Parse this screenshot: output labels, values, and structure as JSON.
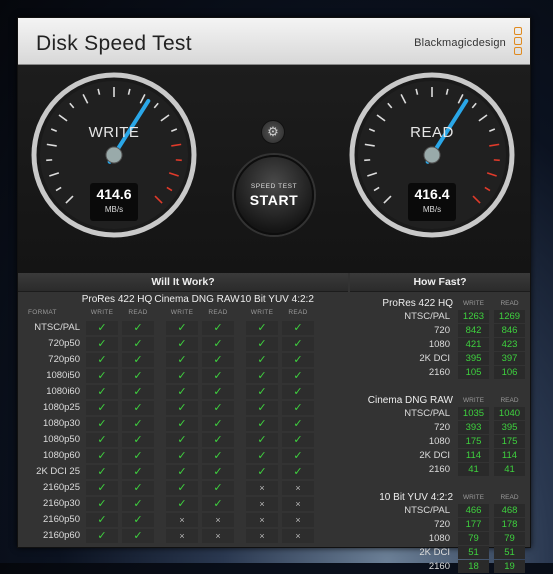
{
  "window": {
    "title": "Disk Speed Test",
    "brand": "Blackmagicdesign",
    "close_icon": "×"
  },
  "gauges": {
    "write": {
      "label": "WRITE",
      "value": "414.6",
      "unit": "MB/s",
      "fraction": 0.62
    },
    "read": {
      "label": "READ",
      "value": "416.4",
      "unit": "MB/s",
      "fraction": 0.62
    }
  },
  "start_button": {
    "small": "SPEED TEST",
    "big": "START"
  },
  "settings_icon": "gear-icon",
  "will_it_work": {
    "title": "Will It Work?",
    "format_header": "FORMAT",
    "codecs": [
      "ProRes 422 HQ",
      "Cinema DNG RAW",
      "10 Bit YUV 4:2:2"
    ],
    "sub_headers": [
      "WRITE",
      "READ"
    ],
    "rows": [
      {
        "format": "NTSC/PAL",
        "cells": [
          1,
          1,
          1,
          1,
          1,
          1
        ]
      },
      {
        "format": "720p50",
        "cells": [
          1,
          1,
          1,
          1,
          1,
          1
        ]
      },
      {
        "format": "720p60",
        "cells": [
          1,
          1,
          1,
          1,
          1,
          1
        ]
      },
      {
        "format": "1080i50",
        "cells": [
          1,
          1,
          1,
          1,
          1,
          1
        ]
      },
      {
        "format": "1080i60",
        "cells": [
          1,
          1,
          1,
          1,
          1,
          1
        ]
      },
      {
        "format": "1080p25",
        "cells": [
          1,
          1,
          1,
          1,
          1,
          1
        ]
      },
      {
        "format": "1080p30",
        "cells": [
          1,
          1,
          1,
          1,
          1,
          1
        ]
      },
      {
        "format": "1080p50",
        "cells": [
          1,
          1,
          1,
          1,
          1,
          1
        ]
      },
      {
        "format": "1080p60",
        "cells": [
          1,
          1,
          1,
          1,
          1,
          1
        ]
      },
      {
        "format": "2K DCI 25",
        "cells": [
          1,
          1,
          1,
          1,
          1,
          1
        ]
      },
      {
        "format": "2160p25",
        "cells": [
          1,
          1,
          1,
          1,
          0,
          0
        ]
      },
      {
        "format": "2160p30",
        "cells": [
          1,
          1,
          1,
          1,
          0,
          0
        ]
      },
      {
        "format": "2160p50",
        "cells": [
          1,
          1,
          0,
          0,
          0,
          0
        ]
      },
      {
        "format": "2160p60",
        "cells": [
          1,
          1,
          0,
          0,
          0,
          0
        ]
      }
    ],
    "check_glyph": "✓",
    "cross_glyph": "×"
  },
  "how_fast": {
    "title": "How Fast?",
    "sub_headers": [
      "WRITE",
      "READ"
    ],
    "groups": [
      {
        "name": "ProRes 422 HQ",
        "rows": [
          {
            "label": "NTSC/PAL",
            "write": "1263",
            "read": "1269"
          },
          {
            "label": "720",
            "write": "842",
            "read": "846"
          },
          {
            "label": "1080",
            "write": "421",
            "read": "423"
          },
          {
            "label": "2K DCI",
            "write": "395",
            "read": "397"
          },
          {
            "label": "2160",
            "write": "105",
            "read": "106"
          }
        ]
      },
      {
        "name": "Cinema DNG RAW",
        "rows": [
          {
            "label": "NTSC/PAL",
            "write": "1035",
            "read": "1040"
          },
          {
            "label": "720",
            "write": "393",
            "read": "395"
          },
          {
            "label": "1080",
            "write": "175",
            "read": "175"
          },
          {
            "label": "2K DCI",
            "write": "114",
            "read": "114"
          },
          {
            "label": "2160",
            "write": "41",
            "read": "41"
          }
        ]
      },
      {
        "name": "10 Bit YUV 4:2:2",
        "rows": [
          {
            "label": "NTSC/PAL",
            "write": "466",
            "read": "468"
          },
          {
            "label": "720",
            "write": "177",
            "read": "178"
          },
          {
            "label": "1080",
            "write": "79",
            "read": "79"
          },
          {
            "label": "2K DCI",
            "write": "51",
            "read": "51"
          },
          {
            "label": "2160",
            "write": "18",
            "read": "19"
          }
        ]
      }
    ]
  },
  "colors": {
    "check": "#3ed13e",
    "needle": "#2aa7e8",
    "redzone": "#e03a2a",
    "brand_accent": "#e08a1e"
  }
}
